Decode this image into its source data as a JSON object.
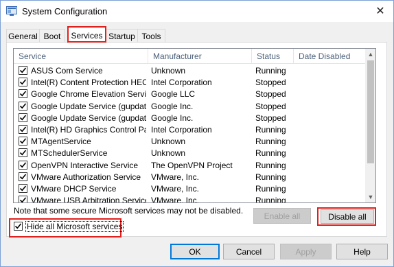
{
  "window": {
    "title": "System Configuration"
  },
  "tabs": [
    {
      "label": "General",
      "active": false
    },
    {
      "label": "Boot",
      "active": false
    },
    {
      "label": "Services",
      "active": true
    },
    {
      "label": "Startup",
      "active": false
    },
    {
      "label": "Tools",
      "active": false
    }
  ],
  "services": {
    "columns": [
      "Service",
      "Manufacturer",
      "Status",
      "Date Disabled"
    ],
    "rows": [
      {
        "checked": true,
        "name": "ASUS Com Service",
        "manufacturer": "Unknown",
        "status": "Running",
        "date_disabled": ""
      },
      {
        "checked": true,
        "name": "Intel(R) Content Protection HEC...",
        "manufacturer": "Intel Corporation",
        "status": "Stopped",
        "date_disabled": ""
      },
      {
        "checked": true,
        "name": "Google Chrome Elevation Servic...",
        "manufacturer": "Google LLC",
        "status": "Stopped",
        "date_disabled": ""
      },
      {
        "checked": true,
        "name": "Google Update Service (gupdate)",
        "manufacturer": "Google Inc.",
        "status": "Stopped",
        "date_disabled": ""
      },
      {
        "checked": true,
        "name": "Google Update Service (gupdatem)",
        "manufacturer": "Google Inc.",
        "status": "Stopped",
        "date_disabled": ""
      },
      {
        "checked": true,
        "name": "Intel(R) HD Graphics Control Pa...",
        "manufacturer": "Intel Corporation",
        "status": "Running",
        "date_disabled": ""
      },
      {
        "checked": true,
        "name": "MTAgentService",
        "manufacturer": "Unknown",
        "status": "Running",
        "date_disabled": ""
      },
      {
        "checked": true,
        "name": "MTSchedulerService",
        "manufacturer": "Unknown",
        "status": "Running",
        "date_disabled": ""
      },
      {
        "checked": true,
        "name": "OpenVPN Interactive Service",
        "manufacturer": "The OpenVPN Project",
        "status": "Running",
        "date_disabled": ""
      },
      {
        "checked": true,
        "name": "VMware Authorization Service",
        "manufacturer": "VMware, Inc.",
        "status": "Running",
        "date_disabled": ""
      },
      {
        "checked": true,
        "name": "VMware DHCP Service",
        "manufacturer": "VMware, Inc.",
        "status": "Running",
        "date_disabled": ""
      },
      {
        "checked": true,
        "name": "VMware USB Arbitration Service",
        "manufacturer": "VMware, Inc.",
        "status": "Running",
        "date_disabled": ""
      }
    ]
  },
  "note": "Note that some secure Microsoft services may not be disabled.",
  "hide_microsoft": {
    "label": "Hide all Microsoft services",
    "checked": true
  },
  "buttons": {
    "enable_all": "Enable all",
    "disable_all": "Disable all",
    "ok": "OK",
    "cancel": "Cancel",
    "apply": "Apply",
    "help": "Help"
  },
  "colors": {
    "highlight": "#e0201c",
    "header_text": "#4c607a",
    "accent": "#0078d7"
  }
}
